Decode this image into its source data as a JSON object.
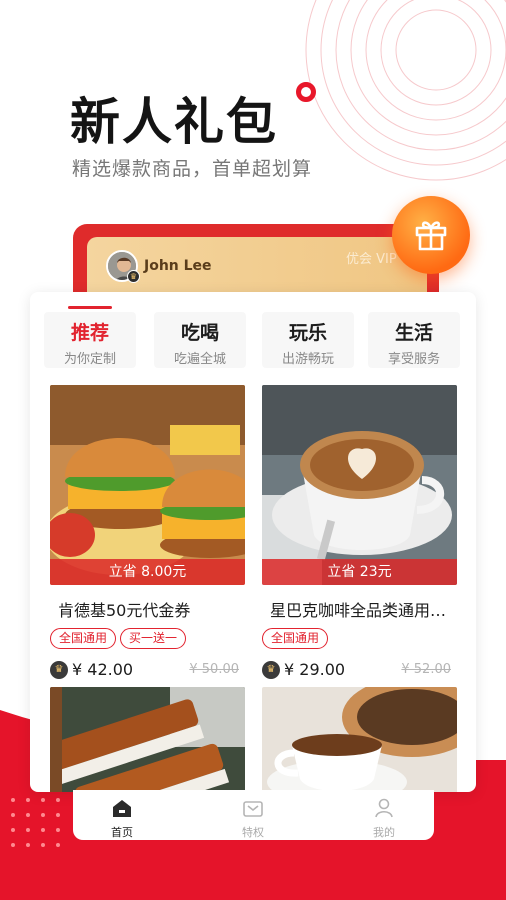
{
  "header": {
    "title": "新人礼包",
    "subtitle": "精选爆款商品，首单超划算"
  },
  "member": {
    "username": "John Lee",
    "card_label": "优会 VIP"
  },
  "tabs": [
    {
      "title": "推荐",
      "sub": "为你定制",
      "active": true
    },
    {
      "title": "吃喝",
      "sub": "吃遍全城",
      "active": false
    },
    {
      "title": "玩乐",
      "sub": "出游畅玩",
      "active": false
    },
    {
      "title": "生活",
      "sub": "享受服务",
      "active": false
    }
  ],
  "products": [
    {
      "save": "立省 8.00元",
      "title": "肯德基50元代金券",
      "tags": [
        "全国通用",
        "买一送一"
      ],
      "price": "¥ 42.00",
      "old_price": "¥ 50.00",
      "image": "burger-photo"
    },
    {
      "save": "立省 23元",
      "title": "星巴克咖啡全品类通用…",
      "tags": [
        "全国通用"
      ],
      "price": "¥ 29.00",
      "old_price": "¥ 52.00",
      "image": "latte-photo"
    },
    {
      "image": "sushi-photo"
    },
    {
      "image": "coffee-cup-photo"
    }
  ],
  "nav": [
    {
      "label": "首页",
      "icon": "home-icon",
      "active": true
    },
    {
      "label": "特权",
      "icon": "privilege-icon",
      "active": false
    },
    {
      "label": "我的",
      "icon": "profile-icon",
      "active": false
    }
  ],
  "colors": {
    "brand_red": "#e2232f",
    "gift_orange": "#ff7a1a",
    "card_gold": "#f2cd8f"
  }
}
